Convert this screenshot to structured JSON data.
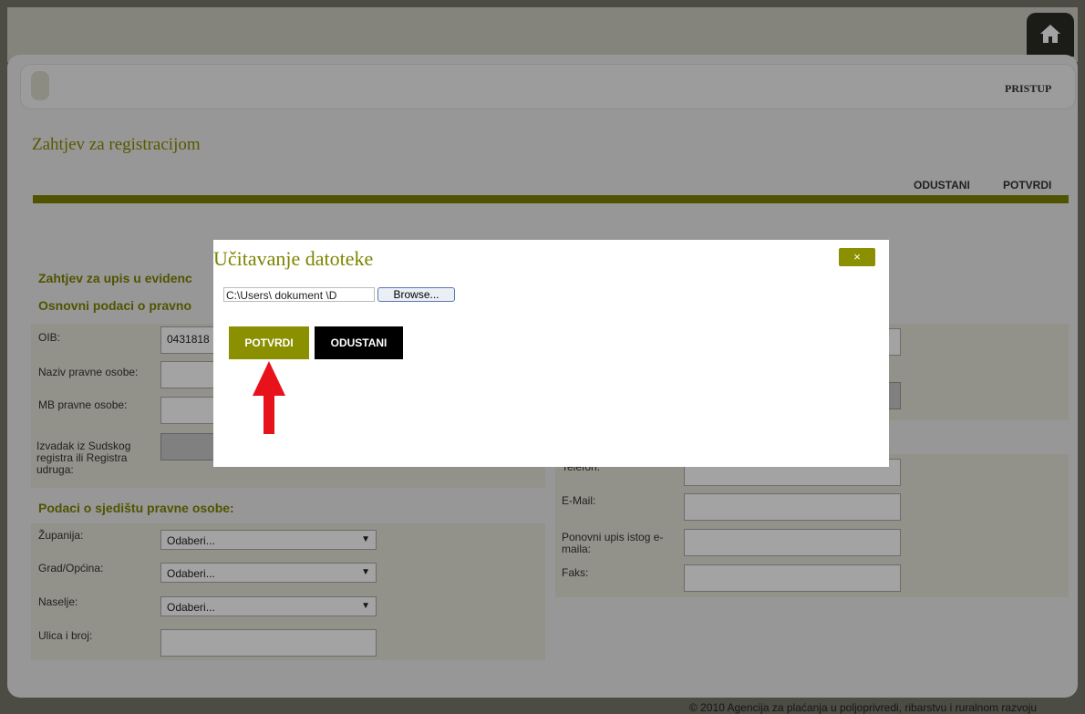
{
  "nav": {
    "pristup": "PRISTUP"
  },
  "page": {
    "title": "Zahtjev za registracijom",
    "actions": {
      "cancel": "ODUSTANI",
      "confirm": "POTVRDI"
    }
  },
  "sections": {
    "upis": "Zahtjev za upis u evidenc",
    "osnovni": "Osnovni podaci o pravno",
    "sjediste": "Podaci o sjedištu pravne osobe:"
  },
  "left_fields": {
    "oib": {
      "label": "OIB:",
      "value": "0431818"
    },
    "naziv": {
      "label": "Naziv pravne osobe:",
      "value": ""
    },
    "mb": {
      "label": "MB pravne osobe:",
      "value": ""
    },
    "izvadak": {
      "label": "Izvadak iz Sudskog registra ili Registra udruga:"
    }
  },
  "address_fields": {
    "zupanija": {
      "label": "Županija:",
      "selected": "Odaberi..."
    },
    "grad": {
      "label": "Grad/Općina:",
      "selected": "Odaberi..."
    },
    "naselje": {
      "label": "Naselje:",
      "selected": "Odaberi..."
    },
    "ulica": {
      "label": "Ulica i broj:",
      "value": ""
    }
  },
  "contact_fields": {
    "telefon": {
      "label": "Telefon:",
      "value": ""
    },
    "email": {
      "label": "E-Mail:",
      "value": ""
    },
    "email_repeat": {
      "label": "Ponovni upis istog e-maila:",
      "value": ""
    },
    "faks": {
      "label": "Faks:",
      "value": ""
    }
  },
  "modal": {
    "title": "Učitavanje datoteke",
    "close": "×",
    "file_path": "C:\\Users\\  dokument  \\D",
    "browse": "Browse...",
    "confirm": "POTVRDI",
    "cancel": "ODUSTANI"
  },
  "footer": "© 2010 Agencija za plaćanja u poljoprivredi, ribarstvu i ruralnom razvoju",
  "colors": {
    "accent": "#8a9000",
    "annotation_arrow": "#e8121a",
    "panel": "#e5e5d8"
  },
  "icons": {
    "home": "home-icon",
    "caret": "chevron-down-icon",
    "arrow": "red-arrow-up"
  }
}
